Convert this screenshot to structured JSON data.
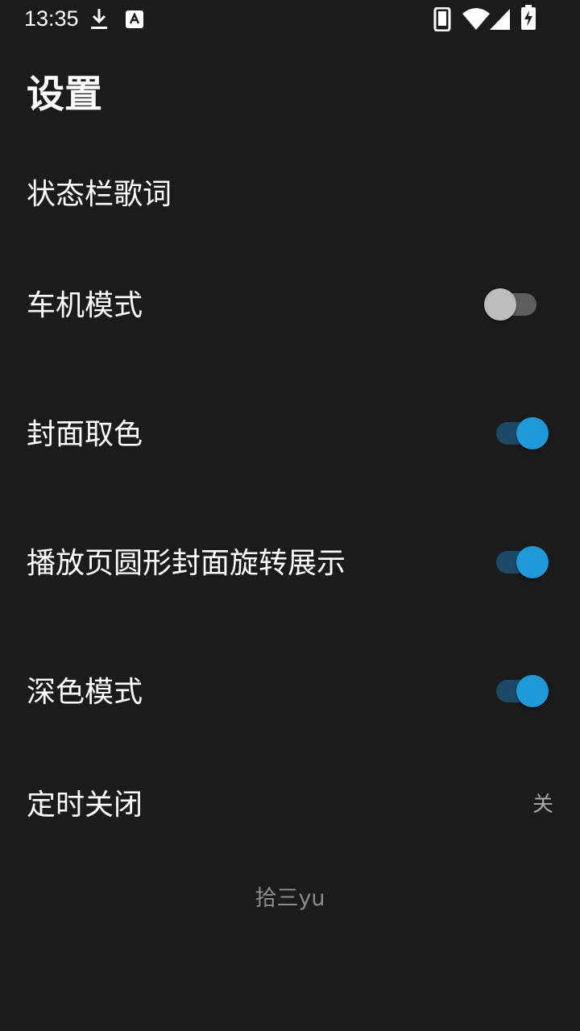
{
  "status_bar": {
    "time": "13:35",
    "icons": [
      "download-icon",
      "a-badge-icon",
      "phone-icon",
      "wifi-icon",
      "signal-icon",
      "battery-charging-icon"
    ]
  },
  "page": {
    "title": "设置"
  },
  "settings": [
    {
      "label": "状态栏歌词"
    },
    {
      "label": "车机模式",
      "toggle": false
    },
    {
      "label": "封面取色",
      "toggle": true
    },
    {
      "label": "播放页圆形封面旋转展示",
      "toggle": true
    },
    {
      "label": "深色模式",
      "toggle": true
    },
    {
      "label": "定时关闭",
      "value": "关"
    }
  ],
  "footer": {
    "credit": "拾三yu"
  },
  "colors": {
    "background": "#1c1b1c",
    "accent": "#1e9ad9",
    "switch_off_thumb": "#bdbdbd"
  }
}
